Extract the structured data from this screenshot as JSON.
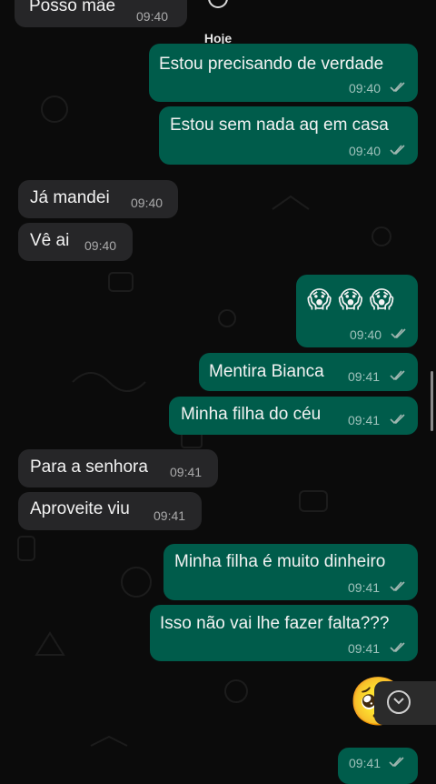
{
  "chat": {
    "top_partial": {
      "text": "Posso mãe",
      "time": "09:40"
    },
    "day_label": "Hoje",
    "messages": [
      {
        "dir": "out",
        "text": "Estou precisando de verdade",
        "time": "09:40",
        "read": true
      },
      {
        "dir": "out",
        "text": "Estou sem nada aq em casa",
        "time": "09:40",
        "read": true
      },
      {
        "dir": "in",
        "text": "Já mandei",
        "time": "09:40"
      },
      {
        "dir": "in",
        "text": "Vê ai",
        "time": "09:40"
      },
      {
        "dir": "out",
        "text": "😱 😱 😱",
        "time": "09:40",
        "read": true
      },
      {
        "dir": "out",
        "text": "Mentira Bianca",
        "time": "09:41",
        "read": true
      },
      {
        "dir": "out",
        "text": "Minha filha do céu",
        "time": "09:41",
        "read": true
      },
      {
        "dir": "in",
        "text": "Para a senhora",
        "time": "09:41"
      },
      {
        "dir": "in",
        "text": "Aproveite viu",
        "time": "09:41"
      },
      {
        "dir": "out",
        "text": "Minha filha é muito dinheiro",
        "time": "09:41",
        "read": true
      },
      {
        "dir": "out",
        "text": "Isso não vai lhe fazer falta???",
        "time": "09:41",
        "read": true
      },
      {
        "dir": "out",
        "text": "🥺",
        "time": "09:41",
        "read": true
      }
    ]
  },
  "colors": {
    "incoming": "#262628",
    "outgoing": "#005c4b",
    "background": "#0b0b0b",
    "read_tick": "#9fb6b0"
  },
  "icons": {
    "read_receipt": "double-check-icon",
    "scroll_down": "chevron-down-icon"
  }
}
